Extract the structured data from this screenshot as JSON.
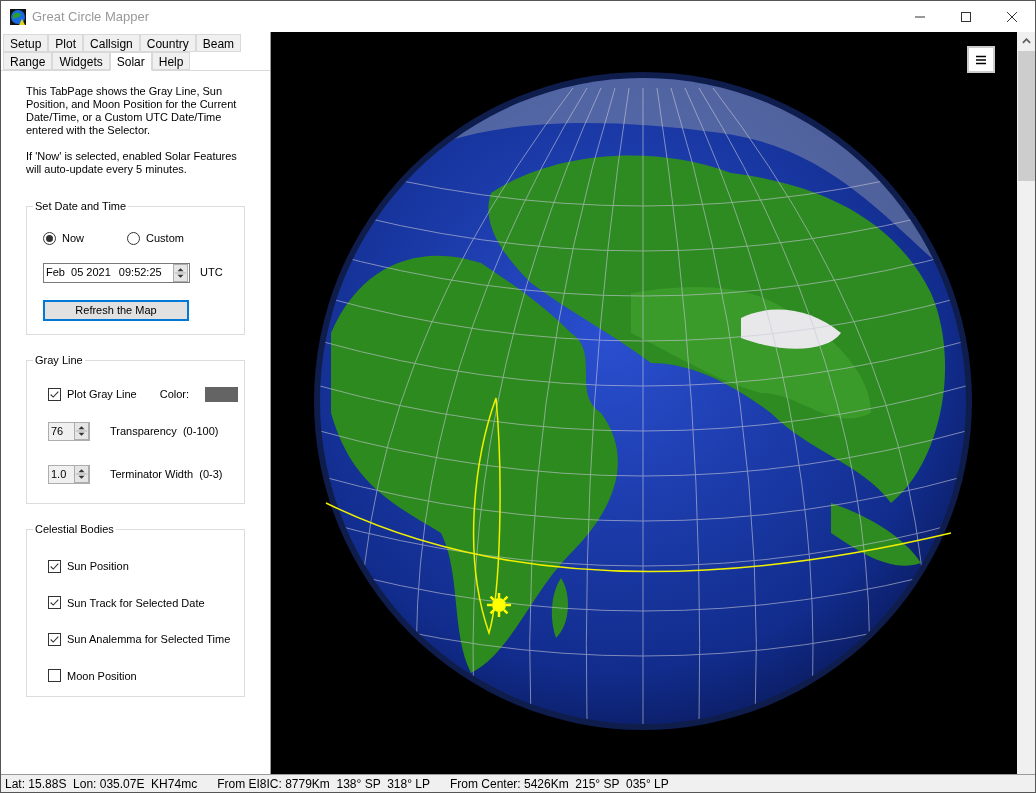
{
  "window": {
    "title": "Great Circle Mapper"
  },
  "tab_rows": [
    [
      {
        "label": "Setup",
        "selected": false
      },
      {
        "label": "Plot",
        "selected": false
      },
      {
        "label": "Callsign",
        "selected": false
      },
      {
        "label": "Country",
        "selected": false
      },
      {
        "label": "Beam",
        "selected": false
      }
    ],
    [
      {
        "label": "Range",
        "selected": false
      },
      {
        "label": "Widgets",
        "selected": false
      },
      {
        "label": "Solar",
        "selected": true
      },
      {
        "label": "Help",
        "selected": false
      }
    ]
  ],
  "description": [
    "This TabPage shows the Gray Line, Sun Position, and Moon Position for the Current Date/Time, or a Custom UTC Date/Time entered with the Selector.",
    "If 'Now' is selected, enabled Solar Features will auto-update every 5 minutes."
  ],
  "date_time_group": {
    "title": "Set Date and Time",
    "options": [
      {
        "label": "Now",
        "selected": true
      },
      {
        "label": "Custom",
        "selected": false
      }
    ],
    "date": "Feb  05 2021",
    "time": "09:52:25",
    "zone": "UTC",
    "refresh_button": "Refresh the Map"
  },
  "gray_line_group": {
    "title": "Gray Line",
    "plot": {
      "label": "Plot Gray Line",
      "checked": true
    },
    "color_label": "Color:",
    "color": "#646464",
    "transparency": {
      "value": "76",
      "label": "Transparency  (0-100)"
    },
    "terminator": {
      "value": "1.0",
      "label": "Terminator Width  (0-3)"
    }
  },
  "celestial_group": {
    "title": "Celestial Bodies",
    "items": [
      {
        "label": "Sun Position",
        "checked": true
      },
      {
        "label": "Sun Track for Selected Date",
        "checked": true
      },
      {
        "label": "Sun Analemma for Selected Time",
        "checked": true
      },
      {
        "label": "Moon Position",
        "checked": false
      }
    ]
  },
  "status_bar": [
    "Lat: 15.88S  Lon: 035.07E  KH74mc",
    "From EI8IC: 8779Km  138° SP  318° LP",
    "From Center: 5426Km  215° SP  035° LP"
  ]
}
